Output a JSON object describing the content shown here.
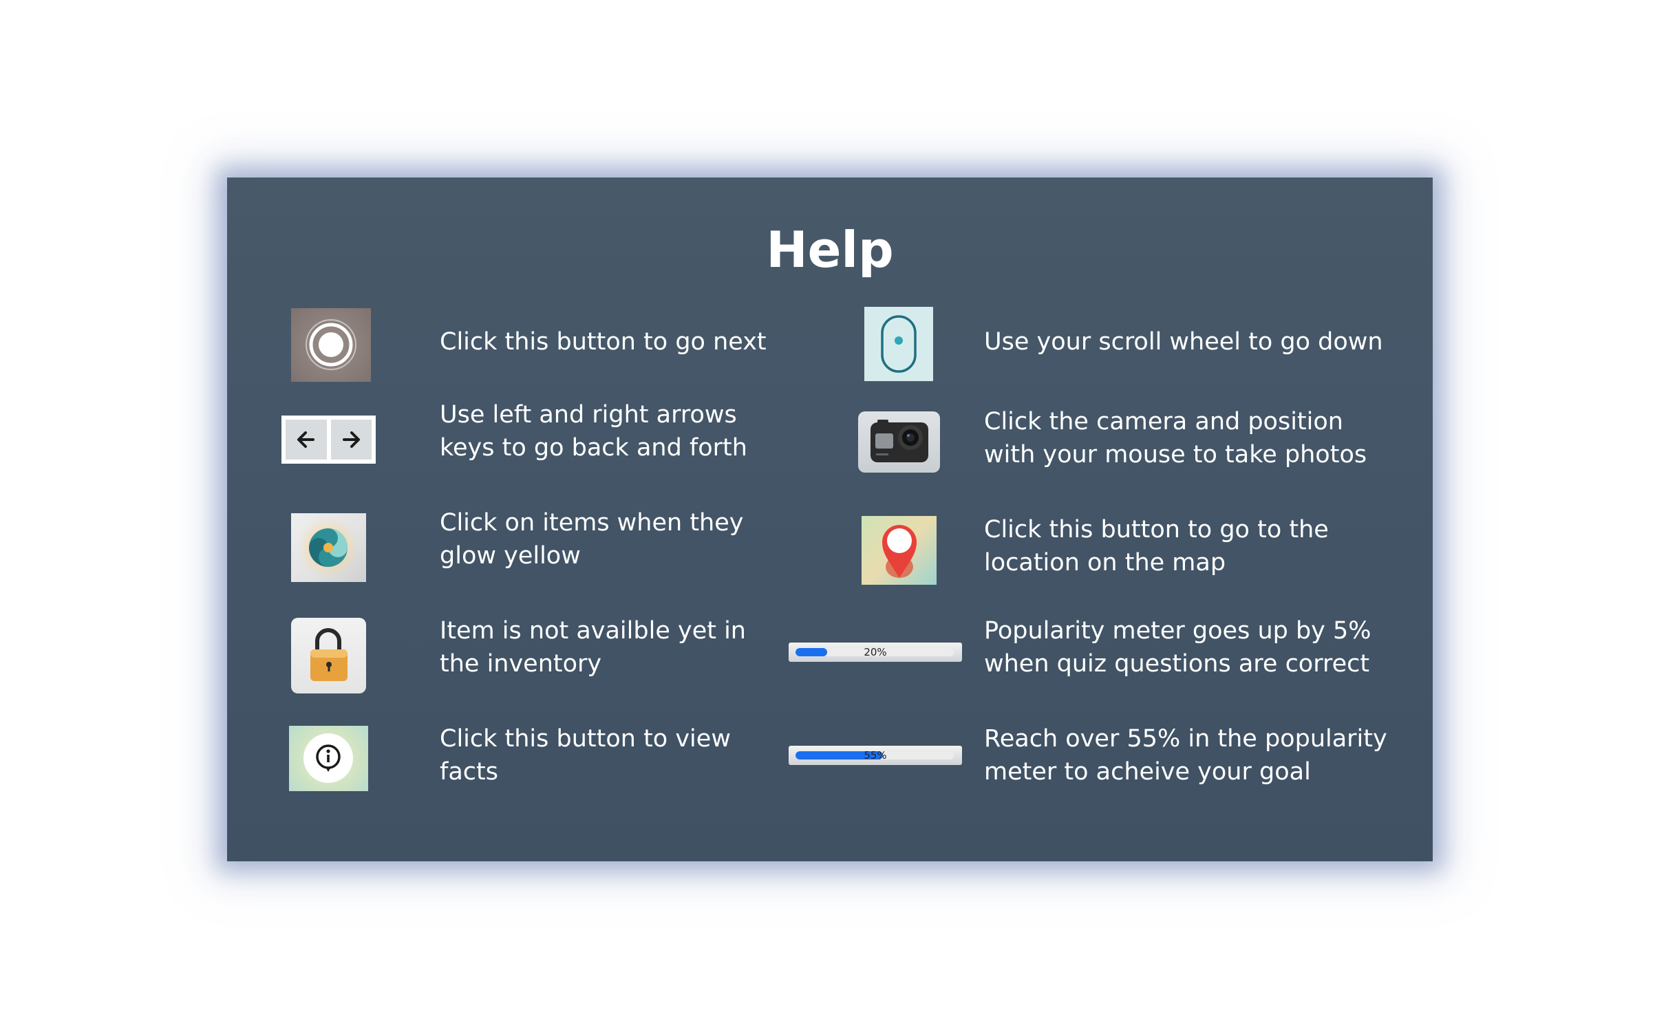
{
  "title": "Help",
  "left_items": [
    {
      "icon": "record-button-icon",
      "text": "Click this button to go next"
    },
    {
      "icon": "arrow-keys-icon",
      "text": "Use left and right arrows\nkeys to go back and forth"
    },
    {
      "icon": "glow-item-icon",
      "text": "Click on items when they\nglow yellow"
    },
    {
      "icon": "lock-icon",
      "text": "Item is not availble yet in\nthe inventory"
    },
    {
      "icon": "info-icon",
      "text": "Click this button to view\nfacts"
    }
  ],
  "right_items": [
    {
      "icon": "mouse-scroll-icon",
      "text": "Use your scroll wheel to go down"
    },
    {
      "icon": "camera-icon",
      "text": "Click the camera and position\nwith your mouse to take photos"
    },
    {
      "icon": "map-pin-icon",
      "text": "Click this button to go to the\nlocation on the map"
    },
    {
      "icon": "popularity-meter",
      "text": "Popularity meter goes up by 5%\nwhen quiz questions are correct"
    },
    {
      "icon": "popularity-meter",
      "text": "Reach over 55% in the popularity\nmeter to acheive your goal"
    }
  ],
  "meters": [
    {
      "label": "20%",
      "value": 0.2
    },
    {
      "label": "55%",
      "value": 0.55
    }
  ],
  "colors": {
    "panel": "#445667",
    "meter_fill": "#1a6ff0",
    "pin": "#e8413a",
    "lock": "#e7a13d"
  }
}
